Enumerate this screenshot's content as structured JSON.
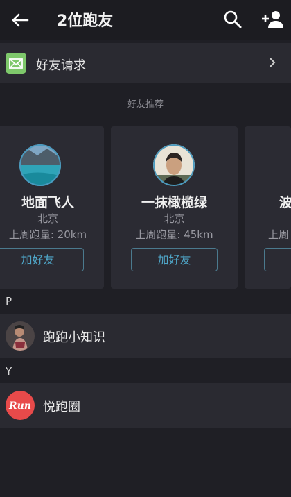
{
  "header": {
    "title": "2位跑友",
    "back_icon": "arrow-left-icon",
    "search_icon": "search-icon",
    "add_icon": "add-person-icon"
  },
  "friend_requests": {
    "label": "好友请求",
    "icon": "mail-icon"
  },
  "recommend": {
    "title": "好友推荐",
    "cards": [
      {
        "name": "地面飞人",
        "city": "北京",
        "distance": "上周跑量: 20km",
        "button": "加好友"
      },
      {
        "name": "一抹橄榄绿",
        "city": "北京",
        "distance": "上周跑量: 45km",
        "button": "加好友"
      },
      {
        "name": "波",
        "city": "",
        "distance": "上周",
        "button": ""
      }
    ]
  },
  "sections": [
    {
      "letter": "P",
      "items": [
        {
          "label": "跑跑小知识"
        }
      ]
    },
    {
      "letter": "Y",
      "items": [
        {
          "label": "悦跑圈",
          "logo_text": "Run"
        }
      ]
    }
  ],
  "colors": {
    "accent": "#4fa6c8",
    "mail_green": "#7ec86b",
    "run_red": "#e84a4a"
  }
}
